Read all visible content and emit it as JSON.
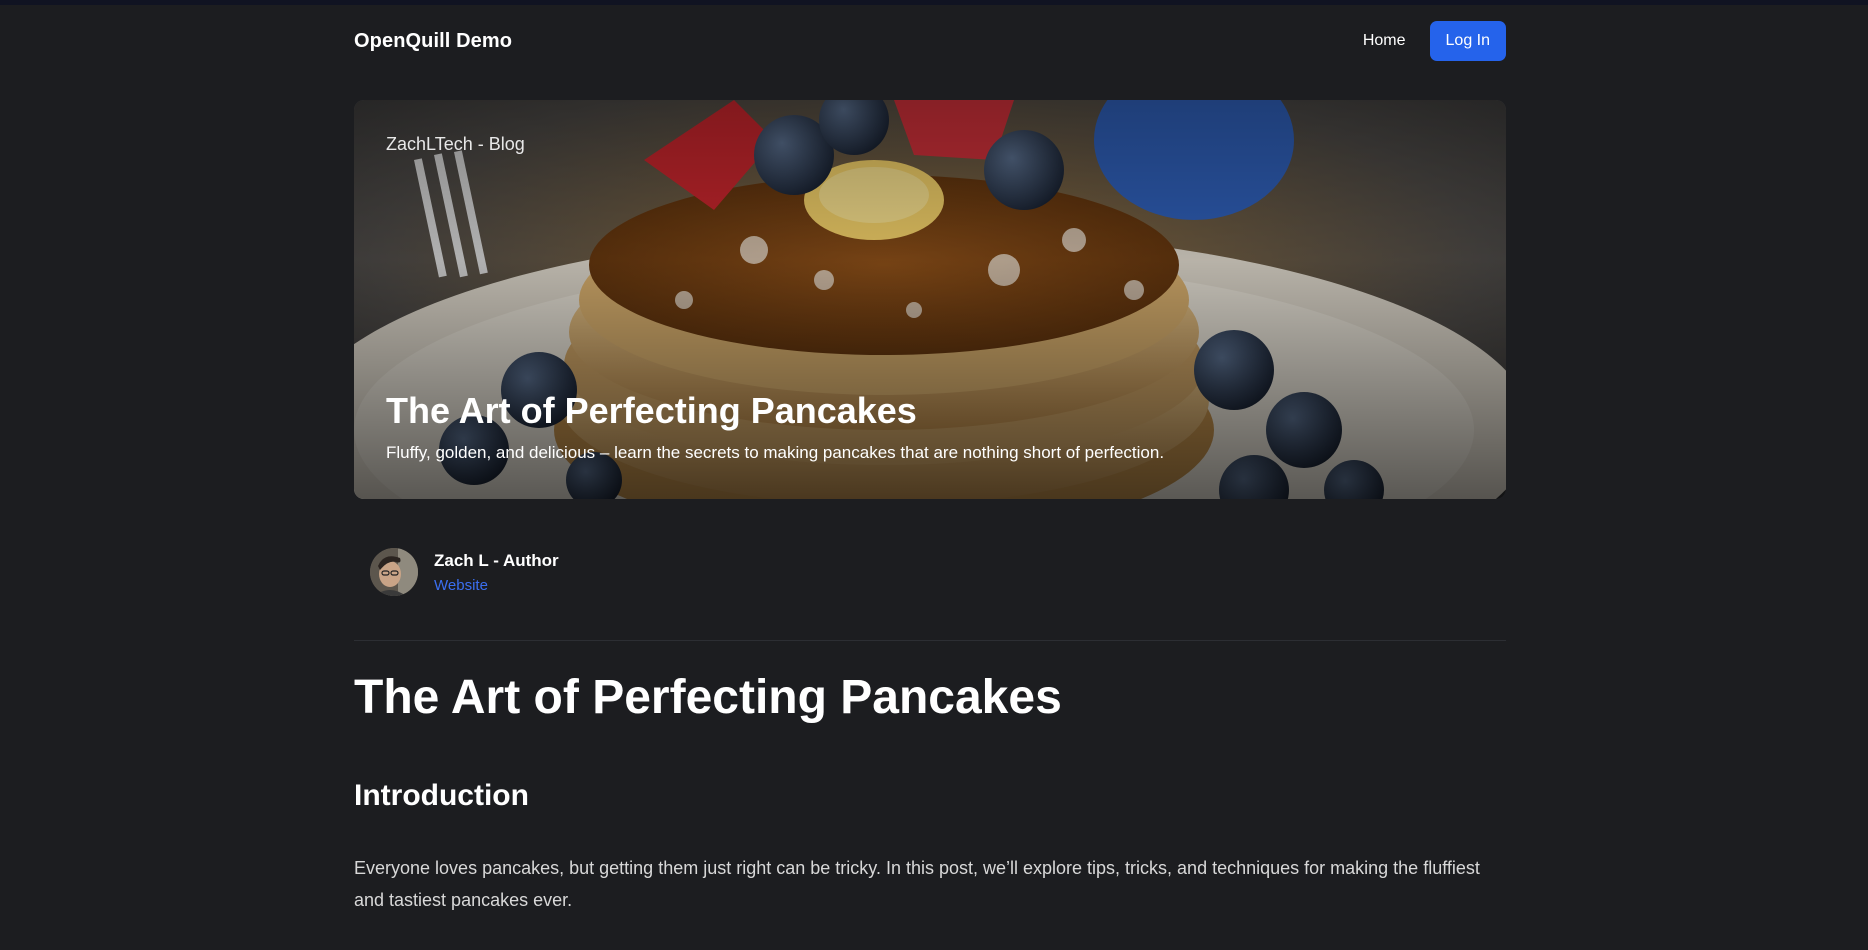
{
  "navbar": {
    "brand": "OpenQuill Demo",
    "home_label": "Home",
    "login_label": "Log In"
  },
  "hero": {
    "tag": "ZachLTech - Blog",
    "title": "The Art of Perfecting Pancakes",
    "subtitle": "Fluffy, golden, and delicious – learn the secrets to making pancakes that are nothing short of perfection.",
    "image": "pancake-stack-with-berries-photo"
  },
  "author": {
    "name": "Zach L - Author",
    "link_label": "Website",
    "avatar": "author-avatar-photo"
  },
  "article": {
    "title": "The Art of Perfecting Pancakes",
    "section_heading": "Introduction",
    "paragraph": "Everyone loves pancakes, but getting them just right can be tricky. In this post, we’ll explore tips, tricks, and techniques for making the fluffiest and tastiest pancakes ever."
  },
  "colors": {
    "background": "#1c1d20",
    "accent": "#2563eb",
    "link": "#3b6ff0"
  }
}
